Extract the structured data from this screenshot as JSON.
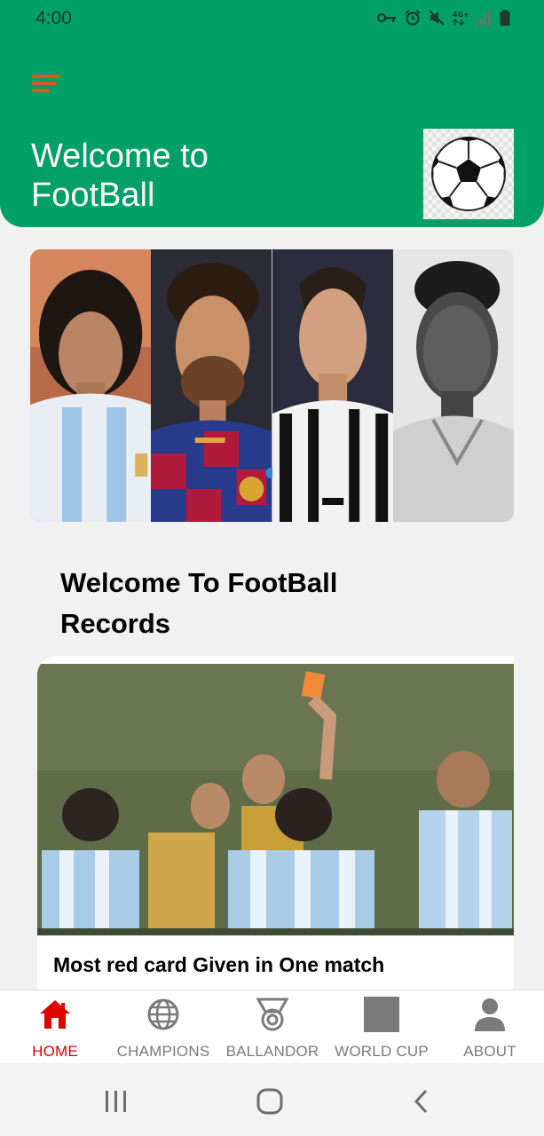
{
  "status_bar": {
    "time": "4:00",
    "icons": [
      "key-icon",
      "alarm-icon",
      "mute-icon",
      "signal-4g-icon",
      "battery-icon"
    ]
  },
  "header": {
    "menu_icon": "hamburger-menu-icon",
    "title": "Welcome to FootBall",
    "logo_icon": "soccer-ball-icon",
    "brand_color": "#00a068",
    "accent_color": "#e5541f"
  },
  "banner": {
    "players": [
      "player-photo-1",
      "player-photo-2",
      "player-photo-3",
      "player-photo-4"
    ]
  },
  "main": {
    "section_title": "Welcome To FootBall Records",
    "card": {
      "image": "red-card-match-photo",
      "caption": "Most red card Given in One match"
    }
  },
  "bottom_nav": {
    "active_color": "#e00000",
    "items": [
      {
        "label": "HOME",
        "icon": "home-icon",
        "active": true
      },
      {
        "label": "CHAMPIONS",
        "icon": "globe-icon",
        "active": false
      },
      {
        "label": "BALLANDOR",
        "icon": "medal-icon",
        "active": false
      },
      {
        "label": "WORLD CUP",
        "icon": "square-icon",
        "active": false
      },
      {
        "label": "ABOUT",
        "icon": "person-icon",
        "active": false
      }
    ]
  },
  "system_nav": [
    "recent-apps-icon",
    "home-circle-icon",
    "back-icon"
  ]
}
